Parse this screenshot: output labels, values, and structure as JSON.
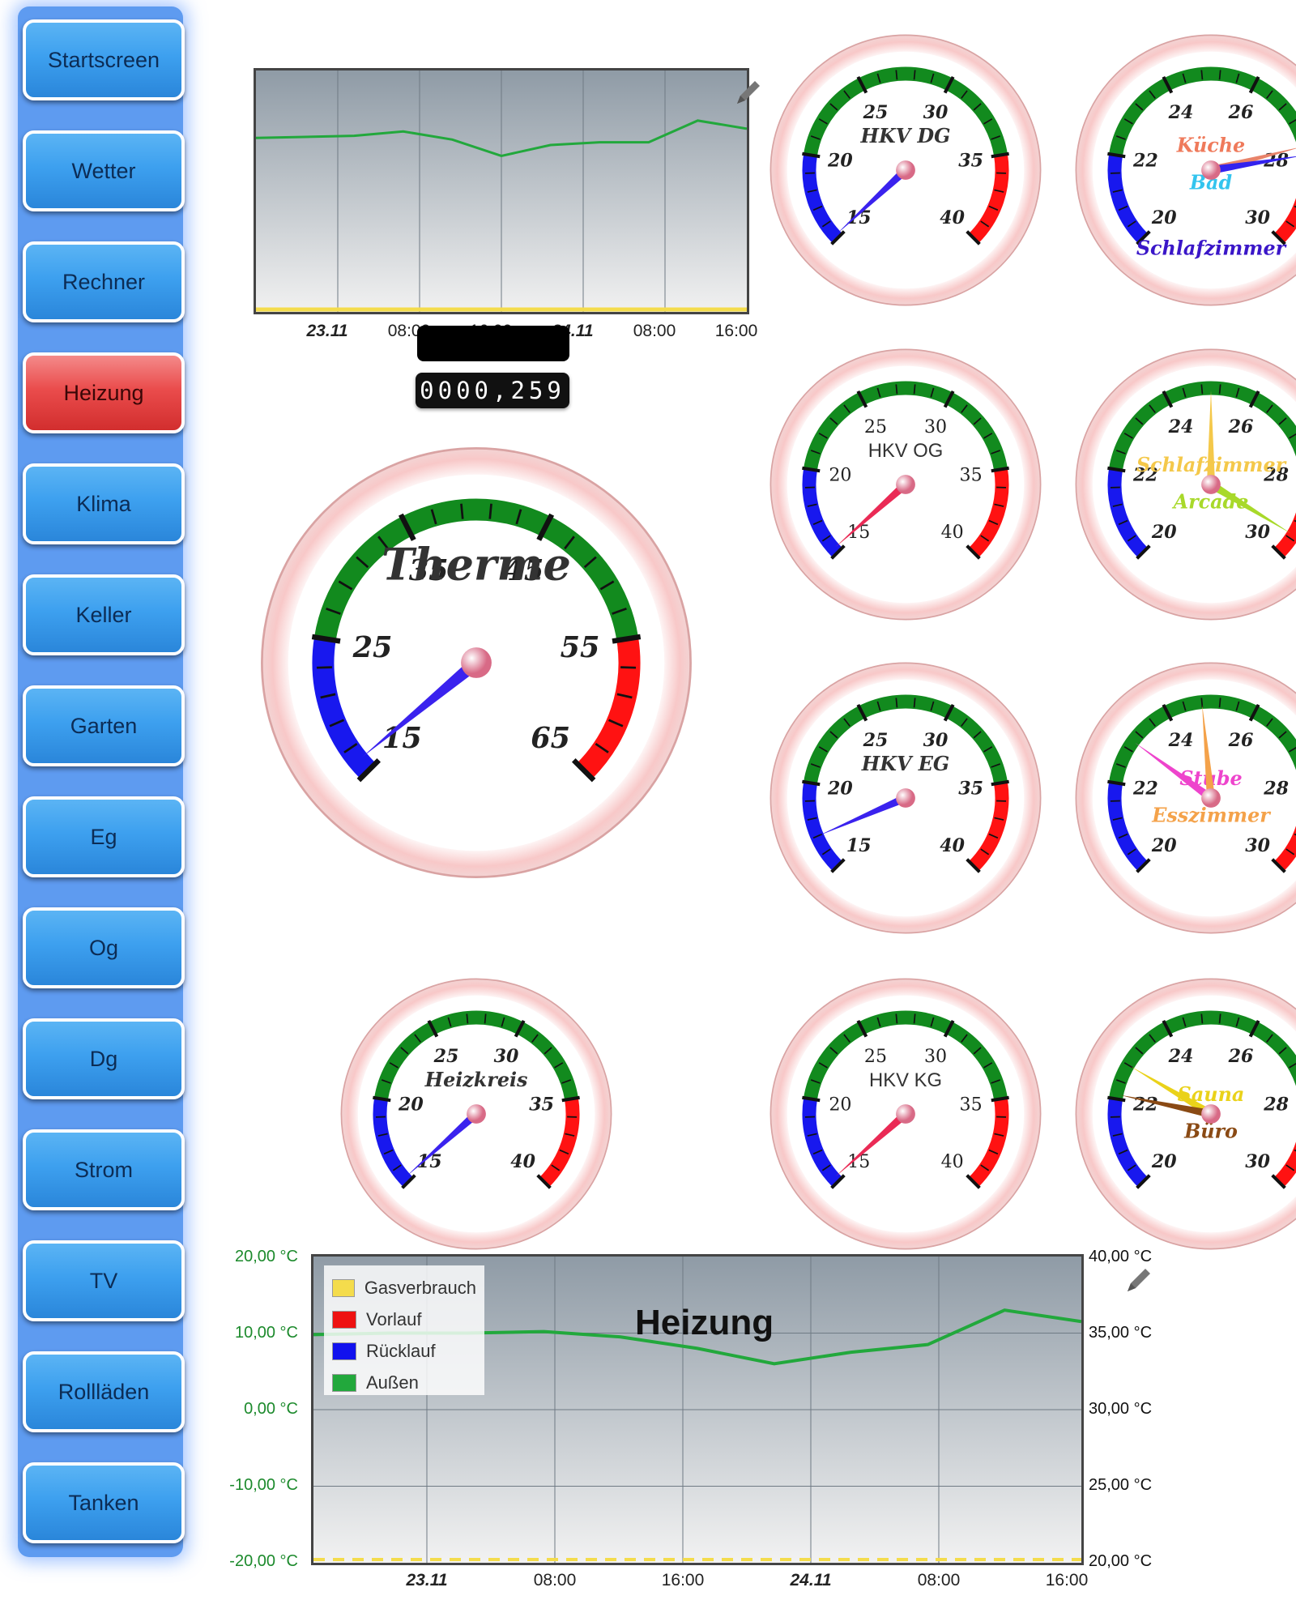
{
  "sidebar": {
    "items": [
      {
        "label": "Startscreen",
        "active": false
      },
      {
        "label": "Wetter",
        "active": false
      },
      {
        "label": "Rechner",
        "active": false
      },
      {
        "label": "Heizung",
        "active": true
      },
      {
        "label": "Klima",
        "active": false
      },
      {
        "label": "Keller",
        "active": false
      },
      {
        "label": "Garten",
        "active": false
      },
      {
        "label": "Eg",
        "active": false
      },
      {
        "label": "Og",
        "active": false
      },
      {
        "label": "Dg",
        "active": false
      },
      {
        "label": "Strom",
        "active": false
      },
      {
        "label": "TV",
        "active": false
      },
      {
        "label": "Rollläden",
        "active": false
      },
      {
        "label": "Tanken",
        "active": false
      }
    ]
  },
  "mini_chart": {
    "x_ticks": [
      {
        "label": "23.11",
        "bold": true
      },
      {
        "label": "08:00",
        "bold": false
      },
      {
        "label": "16:00",
        "bold": false
      },
      {
        "label": "24.11",
        "bold": true
      },
      {
        "label": "08:00",
        "bold": false
      },
      {
        "label": "16:00",
        "bold": false
      }
    ]
  },
  "counter": {
    "value": "0000,259"
  },
  "gauges": [
    {
      "id": "therme",
      "title": "Therme",
      "title_color": "#333333",
      "script": true,
      "ticks": [
        "15",
        "25",
        "35",
        "45",
        "55",
        "65"
      ],
      "needles": [
        {
          "color": "#3a22ee",
          "value": 16
        }
      ]
    },
    {
      "id": "hkv-dg",
      "title": "HKV DG",
      "title_color": "#333333",
      "script": true,
      "ticks": [
        "15",
        "20",
        "25",
        "30",
        "35",
        "40"
      ],
      "needles": [
        {
          "color": "#3a22ee",
          "value": 15.2
        }
      ]
    },
    {
      "id": "hkv-og",
      "title": "HKV OG",
      "title_color": "#333333",
      "script": false,
      "ticks": [
        "15",
        "20",
        "25",
        "30",
        "35",
        "40"
      ],
      "needles": [
        {
          "color": "#ea2a55",
          "value": 15.3
        }
      ]
    },
    {
      "id": "hkv-eg",
      "title": "HKV EG",
      "title_color": "#333333",
      "script": true,
      "ticks": [
        "15",
        "20",
        "25",
        "30",
        "35",
        "40"
      ],
      "needles": [
        {
          "color": "#3a22ee",
          "value": 17
        }
      ]
    },
    {
      "id": "hkv-kg",
      "title": "HKV KG",
      "title_color": "#333333",
      "script": false,
      "ticks": [
        "15",
        "20",
        "25",
        "30",
        "35",
        "40"
      ],
      "needles": [
        {
          "color": "#ea2a55",
          "value": 15.3
        }
      ]
    },
    {
      "id": "heizkreis",
      "title": "Heizkreis",
      "title_color": "#333333",
      "script": true,
      "ticks": [
        "15",
        "20",
        "25",
        "30",
        "35",
        "40"
      ],
      "needles": [
        {
          "color": "#3a22ee",
          "value": 15.3
        }
      ]
    },
    {
      "id": "kueche-bad",
      "labels": [
        {
          "text": "Küche",
          "color": "#ef7a5b",
          "dy": -38
        },
        {
          "text": "Bad",
          "color": "#33c4ee",
          "dy": 22
        },
        {
          "text": "Schlafzimmer",
          "color": "#3a16c8",
          "dy": 128
        }
      ],
      "script": true,
      "ticks": [
        "20",
        "22",
        "24",
        "26",
        "28",
        "30"
      ],
      "needles": [
        {
          "color": "#e8836a",
          "value": 27.8
        },
        {
          "color": "#3322ee",
          "value": 28
        }
      ]
    },
    {
      "id": "schlafzimmer-arcade",
      "labels": [
        {
          "text": "Schlafzimmer",
          "color": "#f4c84a",
          "dy": -30
        },
        {
          "text": "Arcade",
          "color": "#a8d92a",
          "dy": 30
        }
      ],
      "script": true,
      "ticks": [
        "20",
        "22",
        "24",
        "26",
        "28",
        "30"
      ],
      "needles": [
        {
          "color": "#f4c84a",
          "value": 25
        },
        {
          "color": "#a8d92a",
          "value": 29.5
        }
      ]
    },
    {
      "id": "stube-esszimmer",
      "labels": [
        {
          "text": "Stube",
          "color": "#ee44cc",
          "dy": -30
        },
        {
          "text": "Esszimmer",
          "color": "#f4a24a",
          "dy": 30
        }
      ],
      "script": true,
      "ticks": [
        "20",
        "22",
        "24",
        "26",
        "28",
        "30"
      ],
      "needles": [
        {
          "color": "#f4a24a",
          "value": 24.8
        },
        {
          "color": "#ee44cc",
          "value": 23
        }
      ]
    },
    {
      "id": "sauna-buero",
      "labels": [
        {
          "text": "Sauna",
          "color": "#ead21a",
          "dy": -30
        },
        {
          "text": "Büro",
          "color": "#8a4a14",
          "dy": 30
        }
      ],
      "script": true,
      "ticks": [
        "20",
        "22",
        "24",
        "26",
        "28",
        "30"
      ],
      "needles": [
        {
          "color": "#ead21a",
          "value": 22.8
        },
        {
          "color": "#8a4a14",
          "value": 22.1
        }
      ]
    }
  ],
  "main_chart": {
    "title": "Heizung",
    "y_left": [
      "20,00 °C",
      "10,00 °C",
      "0,00 °C",
      "-10,00 °C",
      "-20,00 °C"
    ],
    "y_right": [
      "40,00 °C",
      "35,00 °C",
      "30,00 °C",
      "25,00 °C",
      "20,00 °C"
    ],
    "x_ticks": [
      {
        "label": "23.11",
        "bold": true
      },
      {
        "label": "08:00",
        "bold": false
      },
      {
        "label": "16:00",
        "bold": false
      },
      {
        "label": "24.11",
        "bold": true
      },
      {
        "label": "08:00",
        "bold": false
      },
      {
        "label": "16:00",
        "bold": false
      }
    ],
    "legend": [
      {
        "label": "Gasverbrauch",
        "color": "#f4dc4c"
      },
      {
        "label": "Vorlauf",
        "color": "#ee1111"
      },
      {
        "label": "Rücklauf",
        "color": "#1111ee"
      },
      {
        "label": "Außen",
        "color": "#22a83c"
      }
    ]
  },
  "chart_data": [
    {
      "type": "line",
      "x": [
        "23.11 00:00",
        "23.11 04:00",
        "23.11 08:00",
        "23.11 12:00",
        "23.11 16:00",
        "23.11 20:00",
        "24.11 00:00",
        "24.11 04:00",
        "24.11 08:00",
        "24.11 12:00",
        "24.11 16:00"
      ],
      "series": [
        {
          "name": "Außen",
          "values": [
            9.8,
            10.0,
            10.2,
            11.0,
            9.5,
            6.5,
            8.5,
            9.0,
            9.0,
            13.0,
            11.5
          ]
        }
      ],
      "ylim": [
        -20,
        20
      ]
    },
    {
      "type": "line",
      "title": "Heizung",
      "x": [
        "23.11 00:00",
        "23.11 04:00",
        "23.11 08:00",
        "23.11 12:00",
        "23.11 16:00",
        "23.11 20:00",
        "24.11 00:00",
        "24.11 04:00",
        "24.11 08:00",
        "24.11 12:00",
        "24.11 16:00"
      ],
      "series": [
        {
          "name": "Außen",
          "values": [
            9.8,
            10.0,
            10.0,
            10.2,
            9.5,
            8.0,
            6.0,
            7.5,
            8.5,
            13.0,
            11.5
          ]
        },
        {
          "name": "Gasverbrauch",
          "values": [
            0,
            0,
            0,
            0,
            0,
            0,
            0,
            0,
            0,
            0,
            0
          ]
        }
      ],
      "ylim_left": [
        -20,
        20
      ],
      "ylim_right": [
        20,
        40
      ],
      "legend_position": "top-left"
    }
  ]
}
